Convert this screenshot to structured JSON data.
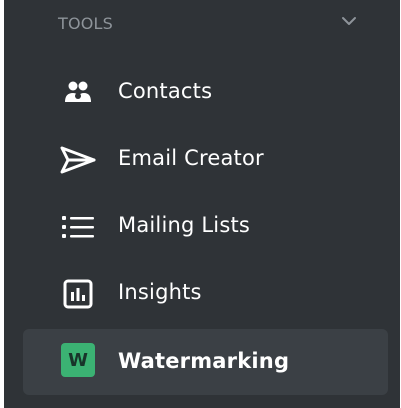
{
  "section": {
    "title": "TOOLS",
    "chevron_icon": "chevron-down-icon"
  },
  "nav": {
    "items": [
      {
        "label": "Contacts",
        "icon": "contacts-icon"
      },
      {
        "label": "Email Creator",
        "icon": "paper-plane-icon"
      },
      {
        "label": "Mailing Lists",
        "icon": "list-icon"
      },
      {
        "label": "Insights",
        "icon": "bar-chart-icon"
      },
      {
        "label": "Watermarking",
        "icon": "watermark-badge-icon",
        "badge_text": "W",
        "active": true
      }
    ]
  },
  "colors": {
    "sidebar_bg": "#2f3337",
    "active_item_bg": "#3b4045",
    "badge_green": "#3bb273",
    "header_text": "#8e949a",
    "item_text": "#ffffff"
  }
}
